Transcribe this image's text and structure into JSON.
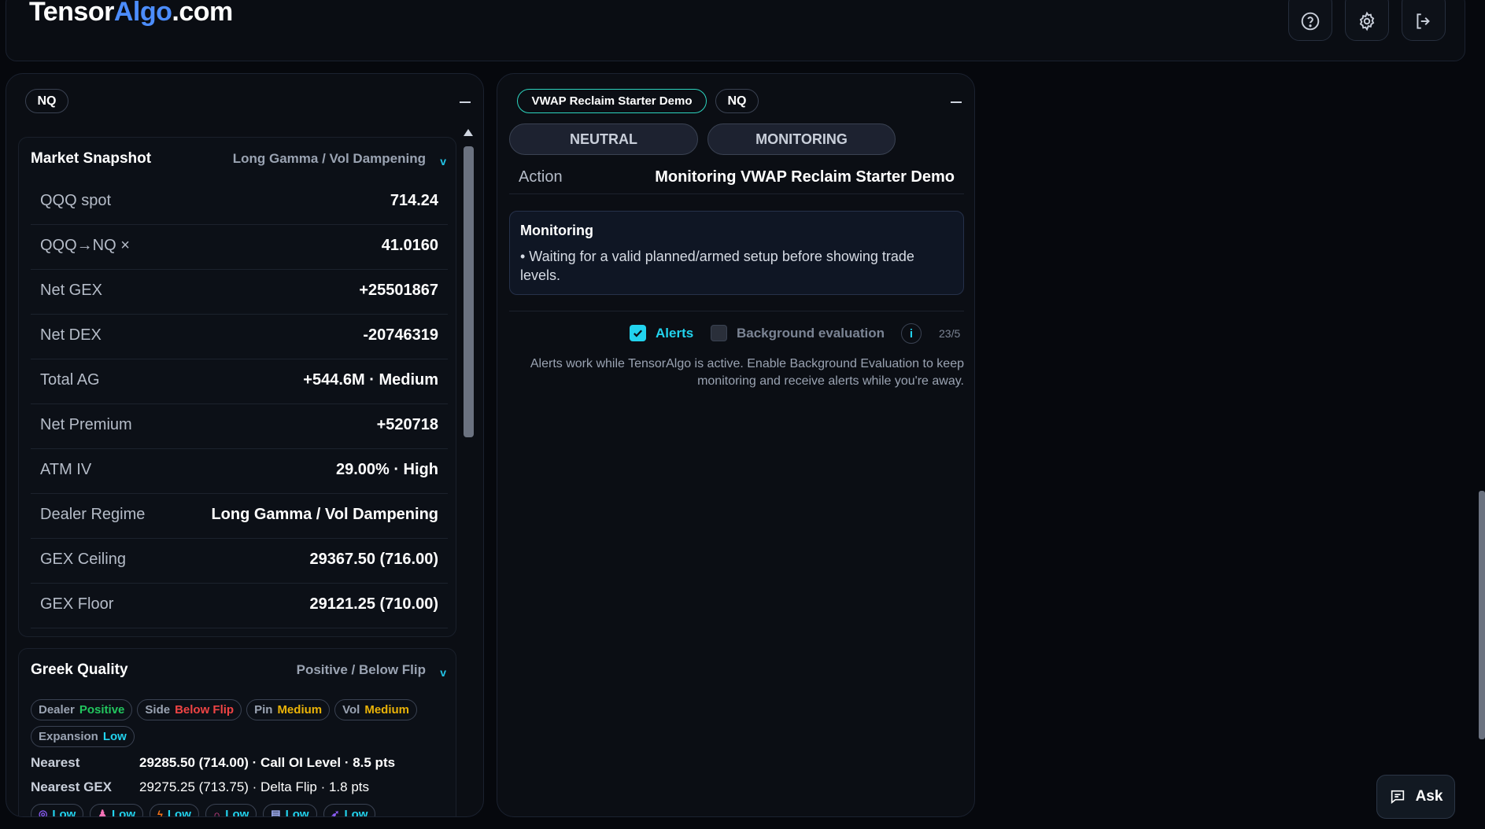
{
  "header": {
    "logo_part1": "Tensor",
    "logo_part2": "Algo",
    "logo_part3": ".com",
    "icons": [
      "help-circle-icon",
      "gear-icon",
      "logout-icon"
    ]
  },
  "left_panel": {
    "symbol": "NQ",
    "market_snapshot": {
      "title": "Market Snapshot",
      "subtitle": "Long Gamma / Vol Dampening",
      "rows": [
        {
          "label": "QQQ spot",
          "value": "714.24"
        },
        {
          "label": "QQQ→NQ ×",
          "value": "41.0160"
        },
        {
          "label": "Net GEX",
          "value": "+25501867"
        },
        {
          "label": "Net DEX",
          "value": "-20746319"
        },
        {
          "label": "Total AG",
          "value": "+544.6M · Medium"
        },
        {
          "label": "Net Premium",
          "value": "+520718"
        },
        {
          "label": "ATM IV",
          "value": "29.00% · High"
        },
        {
          "label": "Dealer Regime",
          "value": "Long Gamma / Vol Dampening"
        },
        {
          "label": "GEX Ceiling",
          "value": "29367.50 (716.00)"
        },
        {
          "label": "GEX Floor",
          "value": "29121.25 (710.00)"
        }
      ]
    },
    "greek_quality": {
      "title": "Greek Quality",
      "subtitle": "Positive / Below Flip",
      "tags": [
        {
          "key": "Dealer",
          "val": "Positive"
        },
        {
          "key": "Side",
          "val": "Below Flip"
        },
        {
          "key": "Pin",
          "val": "Medium"
        },
        {
          "key": "Vol",
          "val": "Medium"
        },
        {
          "key": "Expansion",
          "val": "Low"
        }
      ],
      "nearest_label": "Nearest",
      "nearest_value": "29285.50 (714.00) · Call OI Level · 8.5 pts",
      "nearest_gex_label": "Nearest GEX",
      "nearest_gex_value": "29275.25 (713.75) · Delta Flip · 1.8 pts",
      "mini_badges": [
        "Low",
        "Low",
        "Low",
        "Low",
        "Low",
        "Low"
      ]
    }
  },
  "right_panel": {
    "strategy": "VWAP Reclaim Starter Demo",
    "symbol": "NQ",
    "bias": "NEUTRAL",
    "state": "MONITORING",
    "action_label": "Action",
    "action_value": "Monitoring VWAP Reclaim Starter Demo",
    "monitor_title": "Monitoring",
    "monitor_body": "• Waiting for a valid planned/armed setup before showing trade levels.",
    "alerts_label": "Alerts",
    "alerts_checked": true,
    "bg_label": "Background evaluation",
    "bg_checked": false,
    "info": "i",
    "count": "23/5",
    "note": "Alerts work while TensorAlgo is active. Enable Background Evaluation to keep monitoring and receive alerts while you're away."
  },
  "ask_button": "Ask"
}
